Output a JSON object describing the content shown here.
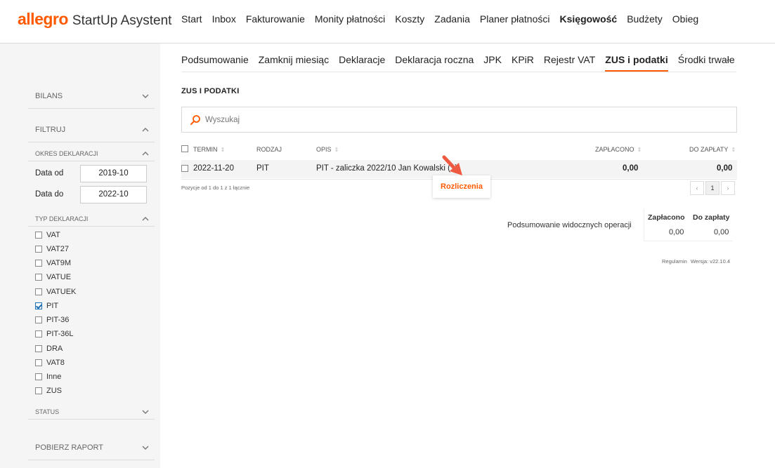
{
  "app": {
    "logo": "allegro",
    "name": "StartUp Asystent"
  },
  "topnav": [
    {
      "label": "Start"
    },
    {
      "label": "Inbox"
    },
    {
      "label": "Fakturowanie"
    },
    {
      "label": "Monity płatności"
    },
    {
      "label": "Koszty"
    },
    {
      "label": "Zadania"
    },
    {
      "label": "Planer płatności"
    },
    {
      "label": "Księgowość",
      "active": true
    },
    {
      "label": "Budżety"
    },
    {
      "label": "Obieg"
    }
  ],
  "subnav": [
    {
      "label": "Podsumowanie"
    },
    {
      "label": "Zamknij miesiąc"
    },
    {
      "label": "Deklaracje"
    },
    {
      "label": "Deklaracja roczna"
    },
    {
      "label": "JPK"
    },
    {
      "label": "KPiR"
    },
    {
      "label": "Rejestr VAT"
    },
    {
      "label": "ZUS i podatki",
      "active": true
    },
    {
      "label": "Środki trwałe"
    }
  ],
  "sidebar": {
    "bilans": "BILANS",
    "filtruj": "FILTRUJ",
    "okres": "OKRES DEKLARACJI",
    "data_od_label": "Data od",
    "data_od_value": "2019-10",
    "data_do_label": "Data do",
    "data_do_value": "2022-10",
    "typ": "TYP DEKLARACJI",
    "types": [
      {
        "label": "VAT",
        "checked": false
      },
      {
        "label": "VAT27",
        "checked": false
      },
      {
        "label": "VAT9M",
        "checked": false
      },
      {
        "label": "VATUE",
        "checked": false
      },
      {
        "label": "VATUEK",
        "checked": false
      },
      {
        "label": "PIT",
        "checked": true
      },
      {
        "label": "PIT-36",
        "checked": false
      },
      {
        "label": "PIT-36L",
        "checked": false
      },
      {
        "label": "DRA",
        "checked": false
      },
      {
        "label": "VAT8",
        "checked": false
      },
      {
        "label": "Inne",
        "checked": false
      },
      {
        "label": "ZUS",
        "checked": false
      }
    ],
    "status": "STATUS",
    "raport": "POBIERZ RAPORT"
  },
  "main": {
    "title": "ZUS I PODATKI",
    "search_placeholder": "Wyszukaj",
    "columns": {
      "termin": "TERMIN",
      "rodzaj": "RODZAJ",
      "opis": "OPIS",
      "zaplacono": "ZAPŁACONO",
      "do_zaplaty": "DO ZAPŁATY"
    },
    "rows": [
      {
        "termin": "2022-11-20",
        "rodzaj": "PIT",
        "opis": "PIT - zaliczka 2022/10 Jan Kowalski (1)",
        "zaplacono": "0,00",
        "do_zaplaty": "0,00"
      }
    ],
    "count_text": "Pozycje od 1 do 1 z 1 łącznie",
    "pager": {
      "prev": "‹",
      "page": "1",
      "next": "›"
    },
    "tooltip": "Rozliczenia",
    "summary": {
      "label": "Podsumowanie widocznych operacji",
      "zaplacono_h": "Zapłacono",
      "do_zaplaty_h": "Do zapłaty",
      "zaplacono_v": "0,00",
      "do_zaplaty_v": "0,00"
    },
    "footer": {
      "regulamin": "Regulamin",
      "wersja": "Wersja: v22.10.4"
    }
  },
  "colors": {
    "accent": "#ff5a00",
    "check": "#1a6fb5"
  }
}
